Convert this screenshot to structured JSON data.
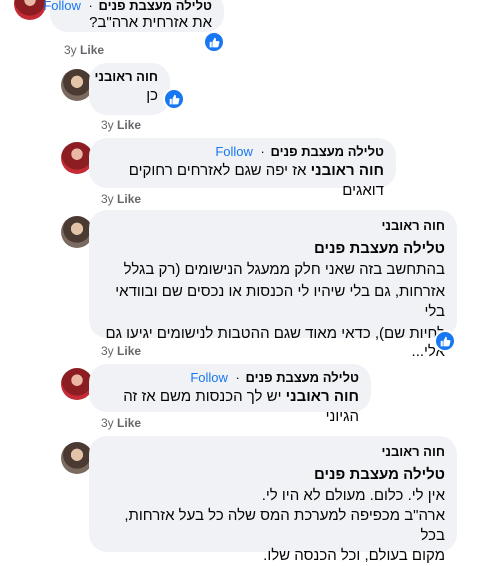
{
  "comments": [
    {
      "author": "טלילה מעצבת פנים",
      "follow": "Follow",
      "text": "את אזרחית ארה\"ב?",
      "time": "3y",
      "like": "Like"
    },
    {
      "author": "חוה ראובני",
      "text": "כן",
      "time": "3y",
      "like": "Like"
    },
    {
      "author": "טלילה מעצבת פנים",
      "follow": "Follow",
      "mention": "חוה ראובני",
      "text": "אז יפה שגם לאזרחים רחוקים דואגים",
      "time": "3y",
      "like": "Like"
    },
    {
      "author": "חוה ראובני",
      "mention": "טלילה מעצבת פנים",
      "lines": [
        "בהתחשב בזה שאני חלק ממעגל הנישומים (רק בגלל",
        "אזרחות, גם בלי שיהיו לי הכנסות או נכסים שם ובוודאי בלי",
        "לחיות שם), כדאי מאוד שגם ההטבות לנישומים יגיעו גם",
        "אלי..."
      ],
      "time": "3y",
      "like": "Like"
    },
    {
      "author": "טלילה מעצבת פנים",
      "follow": "Follow",
      "mention": "חוה ראובני",
      "text": "יש לך הכנסות משם אז זה הגיוני",
      "time": "3y",
      "like": "Like"
    },
    {
      "author": "חוה ראובני",
      "mention": "טלילה מעצבת פנים",
      "lines": [
        "אין לי. כלום. מעולם לא היו לי.",
        "ארה\"ב מכפיפה למערכת המס שלה כל בעל אזרחות, בכל",
        "מקום בעולם, וכל הכנסה שלו."
      ]
    }
  ],
  "dot": "·",
  "colors": {
    "bubble": "#f0f2f5",
    "accent": "#1877f2",
    "muted": "#65676b"
  },
  "icons": {
    "reaction": "thumbs-up-icon"
  }
}
